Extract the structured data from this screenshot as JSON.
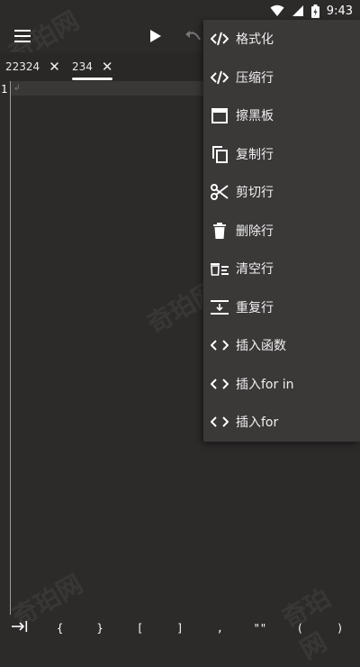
{
  "status_bar": {
    "time": "9:43"
  },
  "tabs": [
    {
      "label": "22324",
      "close": "✕"
    },
    {
      "label": "234",
      "close": "✕"
    }
  ],
  "editor": {
    "line_number": "1",
    "return_mark": "↲"
  },
  "menu": {
    "items": [
      {
        "label": "格式化",
        "icon": "code-icon"
      },
      {
        "label": "压缩行",
        "icon": "code-icon"
      },
      {
        "label": "擦黑板",
        "icon": "calendar-icon"
      },
      {
        "label": "复制行",
        "icon": "copy-icon"
      },
      {
        "label": "剪切行",
        "icon": "scissors-icon"
      },
      {
        "label": "删除行",
        "icon": "trash-icon"
      },
      {
        "label": "清空行",
        "icon": "clear-lines-icon"
      },
      {
        "label": "重复行",
        "icon": "duplicate-line-icon"
      },
      {
        "label": "插入函数",
        "icon": "angle-brackets-icon"
      },
      {
        "label": "插入for in",
        "icon": "angle-brackets-icon"
      },
      {
        "label": "插入for",
        "icon": "angle-brackets-icon"
      }
    ]
  },
  "symbols": [
    "{",
    "}",
    "[",
    "]",
    ",",
    "\"\"",
    "(",
    ")"
  ],
  "watermark": "奇珀网",
  "colors": {
    "background": "#2d2a2a",
    "menu": "#3b3838",
    "text": "#f0f0f0"
  }
}
